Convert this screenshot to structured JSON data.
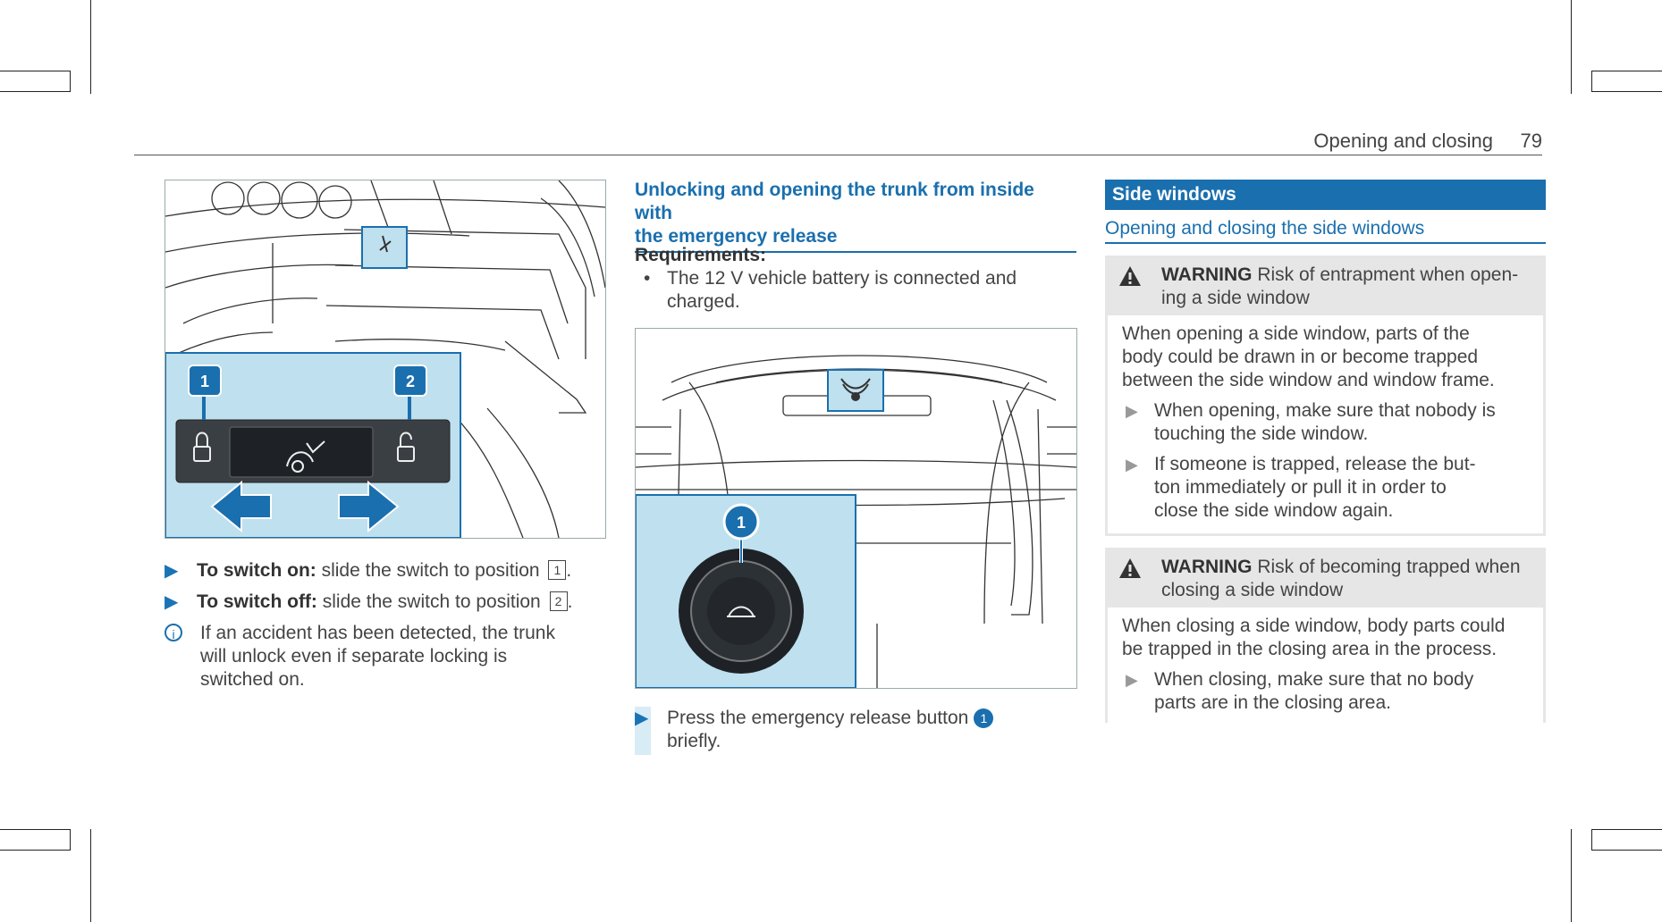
{
  "header": {
    "section": "Opening and closing",
    "page": "79"
  },
  "left": {
    "fig_labels": [
      "1",
      "2"
    ],
    "items": [
      {
        "type": "step",
        "bold": "To switch on:",
        "text": " slide the switch to position ",
        "num": "1",
        "end": "."
      },
      {
        "type": "step",
        "bold": "To switch off:",
        "text": " slide the switch to position ",
        "num": "2",
        "end": "."
      }
    ],
    "info": {
      "lines": [
        "If an accident has been detected, the trunk",
        "will unlock even if separate locking is",
        "switched on."
      ]
    }
  },
  "middle": {
    "heading_lines": [
      "Unlocking and opening the trunk from inside with",
      "the emergency release"
    ],
    "requirements_label": "Requirements:",
    "req_lines": [
      "The 12 V vehicle battery is connected and",
      "charged."
    ],
    "fig_label": "1",
    "step_lines": [
      "Press the emergency release button",
      "briefly."
    ],
    "step_num": "1"
  },
  "right": {
    "section_title": "Side windows",
    "subsection_title": "Opening and closing the side windows",
    "warnings": [
      {
        "label": "WARNING",
        "title_lines": [
          " Risk of entrapment when open-",
          "ing a side window"
        ],
        "body_lines": [
          "When opening a side window, parts of the",
          "body could be drawn in or become trapped",
          "between the side window and window frame."
        ],
        "items": [
          {
            "lines": [
              "When opening, make sure that nobody is",
              "touching the side window."
            ]
          },
          {
            "lines": [
              "If someone is trapped, release the but-",
              "ton immediately or pull it in order to",
              "close the side window again."
            ]
          }
        ]
      },
      {
        "label": "WARNING",
        "title_lines": [
          " Risk of becoming trapped when",
          "closing a side window"
        ],
        "body_lines": [
          "When closing a side window, body parts could",
          "be trapped in the closing area in the process."
        ],
        "items": [
          {
            "lines": [
              "When closing, make sure that no body",
              "parts are in the closing area."
            ]
          }
        ]
      }
    ]
  },
  "colors": {
    "accent": "#1a6fae",
    "callout_fill": "#bfe0ee",
    "warning_bg": "#e6e6e6"
  }
}
